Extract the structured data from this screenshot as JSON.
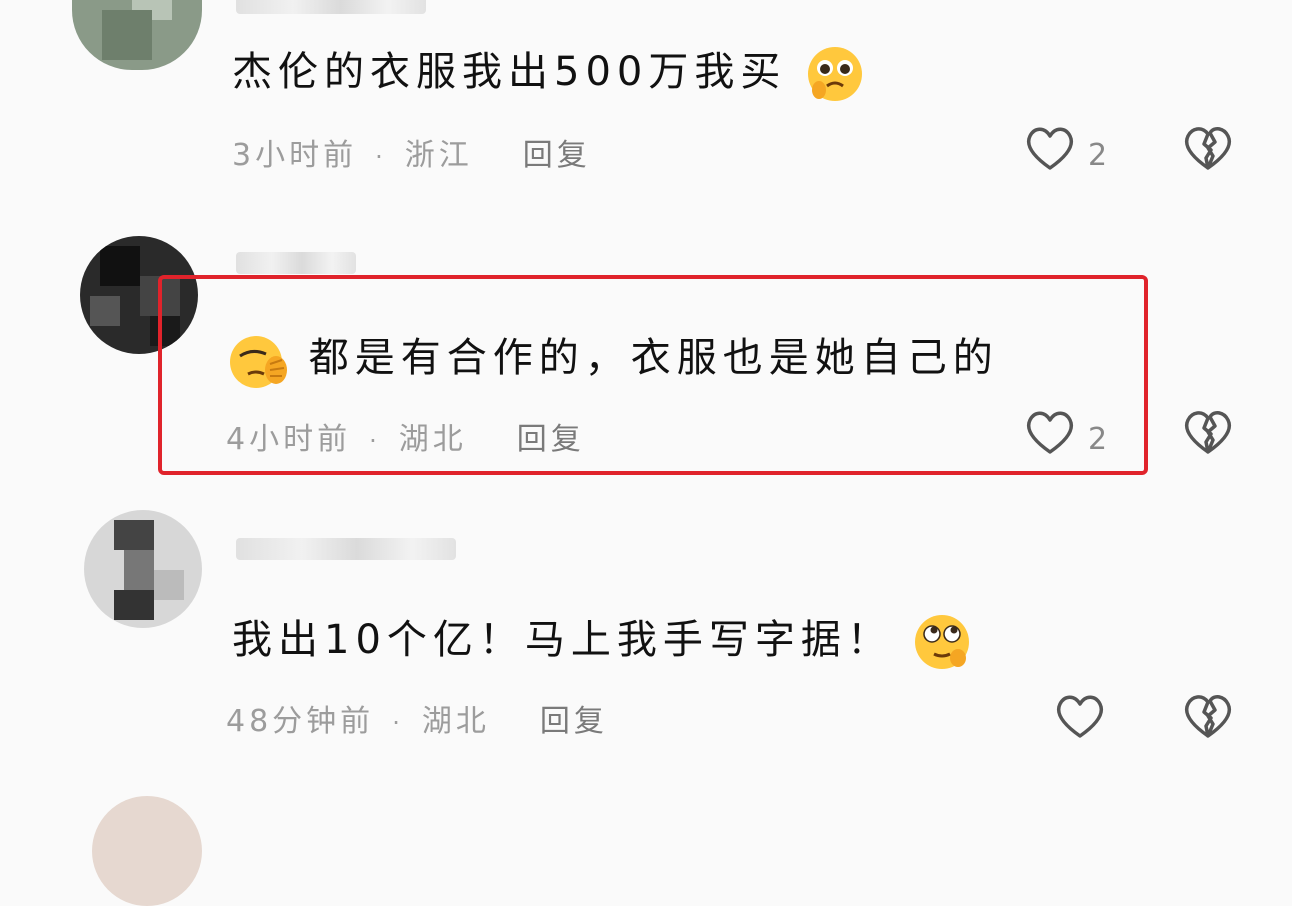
{
  "comments": [
    {
      "text": "杰伦的衣服我出500万我买",
      "time": "3小时前",
      "location": "浙江",
      "reply": "回复",
      "likes": "2",
      "emoji": "pleading-face"
    },
    {
      "text": "都是有合作的，衣服也是她自己的",
      "time": "4小时前",
      "location": "湖北",
      "reply": "回复",
      "likes": "2",
      "emoji": "facepalm-face"
    },
    {
      "text": "我出10个亿！马上我手写字据！",
      "time": "48分钟前",
      "location": "湖北",
      "reply": "回复",
      "likes": "",
      "emoji": "rolling-eyes-face"
    }
  ],
  "colors": {
    "highlight": "#e0232b",
    "text": "#111111",
    "meta": "#9c9c9c"
  }
}
